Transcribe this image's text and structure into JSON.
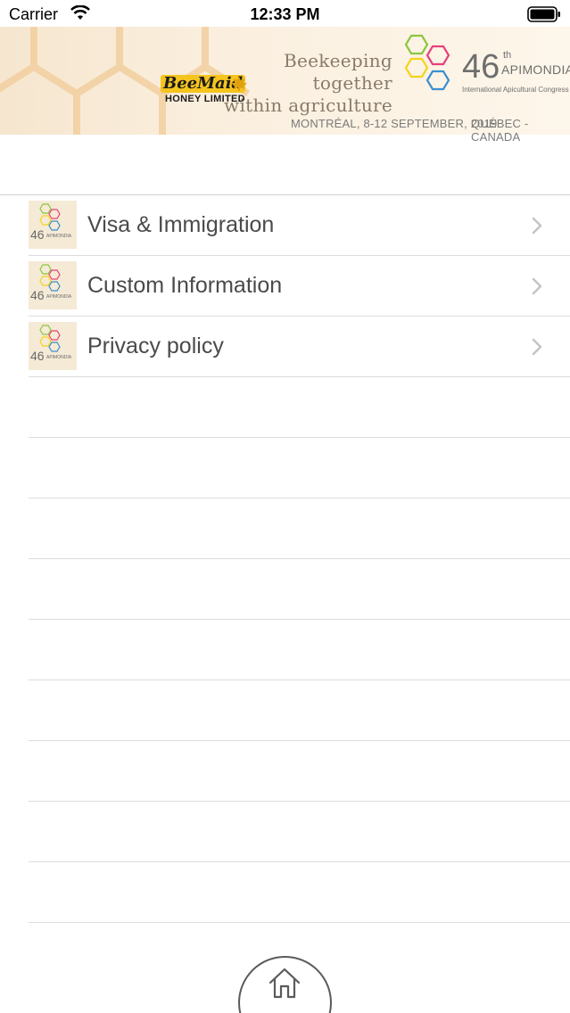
{
  "status_bar": {
    "carrier": "Carrier",
    "time": "12:33 PM",
    "icons": [
      "wifi-icon",
      "battery-icon"
    ]
  },
  "banner": {
    "tagline_line1": "Beekeeping together",
    "tagline_line2": "within agriculture",
    "sponsor_brand": "BeeMaid",
    "sponsor_sub": "HONEY LIMITED",
    "congress_number": "46",
    "congress_suffix": "th",
    "congress_name": "APIMONDIA",
    "congress_subtitle": "International Apicultural Congress",
    "dates": "MONTRÉAL, 8-12 SEPTEMBER, 2019",
    "location": "QUÉBEC - CANADA"
  },
  "menu": {
    "items": [
      {
        "label": "Visa & Immigration",
        "thumb_number": "46",
        "thumb_name": "APIMONDIA"
      },
      {
        "label": "Custom Information",
        "thumb_number": "46",
        "thumb_name": "APIMONDIA"
      },
      {
        "label": "Privacy policy",
        "thumb_number": "46",
        "thumb_name": "APIMONDIA"
      }
    ]
  },
  "colors": {
    "banner_bg": "#f6e6cf",
    "text_primary": "#4a4a4a",
    "separator": "#dcdcdc",
    "hex_green": "#8cc63f",
    "hex_pink": "#e8417a",
    "hex_yellow": "#f5d31a",
    "hex_blue": "#3b8fd0"
  }
}
